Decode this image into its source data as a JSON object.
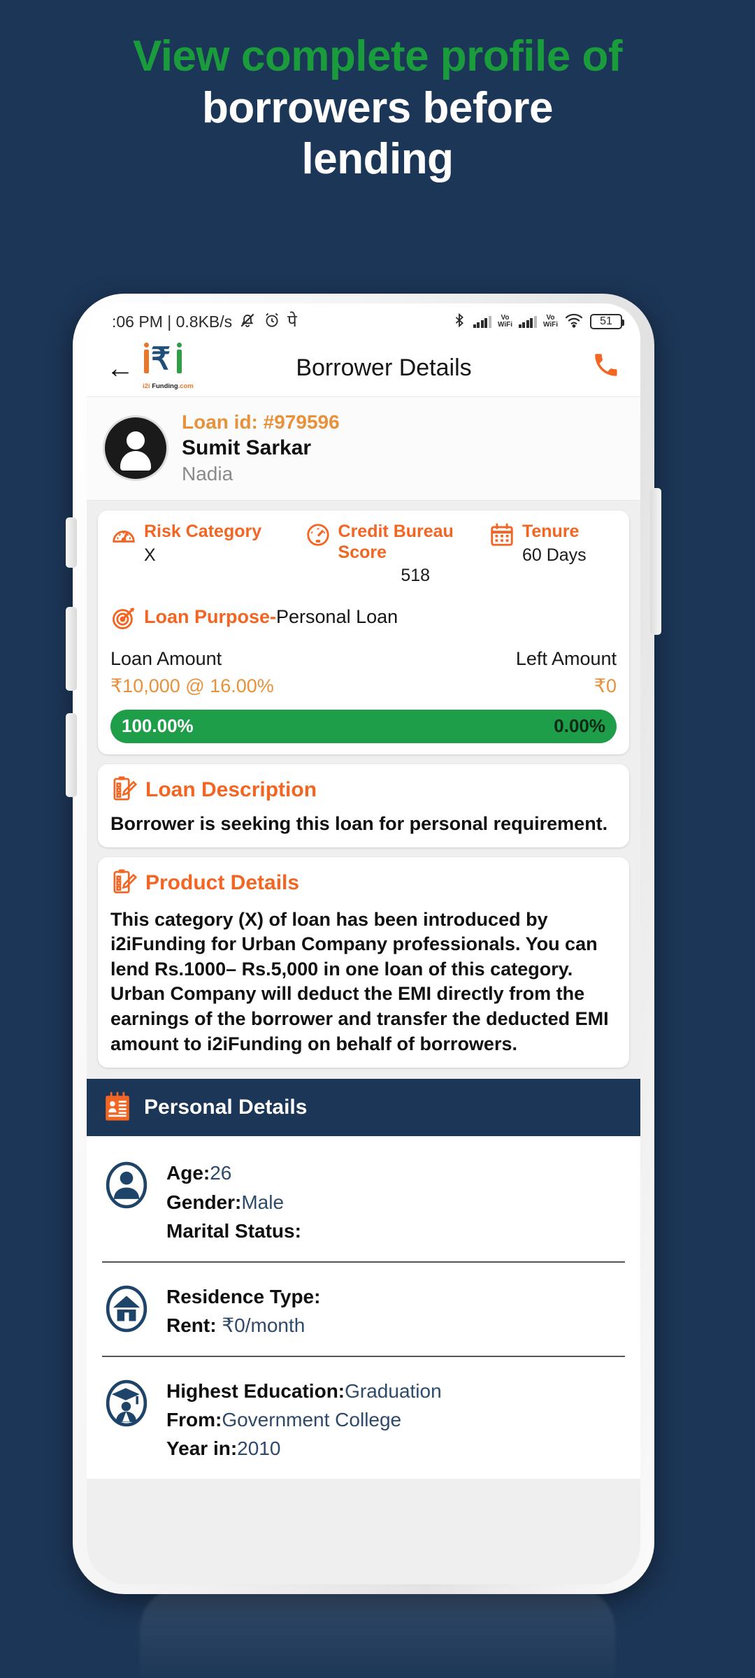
{
  "promo": {
    "line1": "View complete profile of",
    "line2": "borrowers before",
    "line3": "lending",
    "green": "#1a9c3c",
    "bg": "#1c3657"
  },
  "statusbar": {
    "time_and_net": ":06 PM | 0.8KB/s",
    "silent_icon": "bell-muted-icon",
    "alarm_icon": "alarm-clock-icon",
    "pe_icon": "पे",
    "bluetooth_icon": "bluetooth-icon",
    "sim1_label": "Vo\nWiFi",
    "sim1_vo": "Vo",
    "sim1_wifi": "WiFi",
    "sim2_vo": "Vo",
    "sim2_wifi": "WiFi",
    "wifi_icon": "wifi-icon",
    "battery": "51"
  },
  "appbar": {
    "back": "←",
    "logo_rupee": "₹",
    "logo_caption_a": "i2i",
    "logo_caption_b": " Funding",
    "logo_caption_c": ".com",
    "title": "Borrower Details",
    "call_icon": "phone-call-icon",
    "accent": "#f26522"
  },
  "profile": {
    "loan_id": "Loan id: #979596",
    "name": "Sumit  Sarkar",
    "city": "Nadia"
  },
  "metrics": [
    {
      "icon": "risk-gauge-icon",
      "label": "Risk Category",
      "value": "X"
    },
    {
      "icon": "speedometer-icon",
      "label": "Credit Bureau Score",
      "value": "518"
    },
    {
      "icon": "calendar-icon",
      "label": "Tenure",
      "value": "60 Days"
    }
  ],
  "purpose": {
    "icon": "target-icon",
    "label": "Loan Purpose-",
    "value": "Personal Loan"
  },
  "amounts": {
    "loan_label": "Loan Amount",
    "loan_value": "₹10,000 @ 16.00%",
    "left_label": "Left Amount",
    "left_value": "₹0"
  },
  "progress": {
    "funded": "100.00%",
    "remaining": "0.00%",
    "color": "#1e9e48"
  },
  "loan_description": {
    "icon": "clipboard-pen-icon",
    "title": "Loan Description",
    "text": "Borrower is seeking this loan for personal requirement."
  },
  "product_details": {
    "icon": "clipboard-pen-icon",
    "title": "Product Details",
    "text": "This category (X) of loan has been introduced by i2iFunding for Urban Company professionals. You can lend Rs.1000– Rs.5,000 in one loan of this category. Urban Company will deduct the EMI directly from the earnings of the borrower and transfer the deducted EMI amount to i2iFunding on behalf of borrowers."
  },
  "personal_details": {
    "icon": "id-card-icon",
    "title": "Personal Details",
    "rows": [
      {
        "icon": "person-circle-icon",
        "lines": [
          {
            "label": "Age:",
            "value": "26"
          },
          {
            "label": "Gender:",
            "value": "Male"
          },
          {
            "label": "Marital Status:",
            "value": ""
          }
        ]
      },
      {
        "icon": "home-circle-icon",
        "lines": [
          {
            "label": "Residence Type:",
            "value": ""
          },
          {
            "label": "Rent: ",
            "value": "₹0/month"
          }
        ]
      },
      {
        "icon": "graduation-circle-icon",
        "lines": [
          {
            "label": "Highest Education:",
            "value": "Graduation"
          },
          {
            "label": "From:",
            "value": "Government College"
          },
          {
            "label": "Year in:",
            "value": "2010"
          }
        ]
      }
    ]
  }
}
